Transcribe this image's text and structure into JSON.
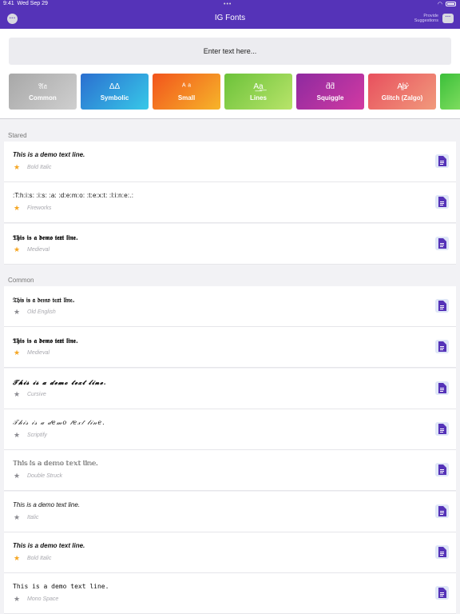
{
  "status": {
    "time": "9:41",
    "date": "Wed Sep 29",
    "dots": "•••",
    "wifi": "◠"
  },
  "header": {
    "title": "IG Fonts",
    "more_icon": "ellipsis-icon",
    "suggest_label_line1": "Provide",
    "suggest_label_line2": "Suggestions",
    "suggest_icon": "chat-bubble-icon"
  },
  "colors": {
    "accent": "#5533b8",
    "star_on": "#f5a623",
    "star_off": "#8a8a90"
  },
  "input": {
    "placeholder": "Enter text here...",
    "value": ""
  },
  "categories": [
    {
      "glyph": "𝔄𝔞",
      "label": "Common"
    },
    {
      "glyph": "ΔΔ",
      "label": "Symbolic"
    },
    {
      "glyph": "ᴬ ᵃ",
      "label": "Small"
    },
    {
      "glyph": "A͟a͟",
      "label": "Lines"
    },
    {
      "glyph": "ƌƌ",
      "label": "Squiggle"
    },
    {
      "glyph": "A̸͚a̷͛",
      "label": "Glitch (Zalgo)"
    },
    {
      "glyph": "",
      "label": ""
    }
  ],
  "stared": {
    "title": "Stared",
    "items": [
      {
        "text": "This is a demo text line.",
        "style": "Bold Italic",
        "starred": true
      },
      {
        "text": ":T:h:i:s: :i:s: :a: :d:e:m:o: :t:e:x:t: :l:i:n:e:.:",
        "style": "Fireworks",
        "starred": true
      },
      {
        "text": "𝕿𝖍𝖎𝖘 𝖎𝖘 𝖆 𝖉𝖊𝖒𝖔 𝖙𝖊𝖝𝖙 𝖑𝖎𝖓𝖊.",
        "style": "Medieval",
        "starred": true
      }
    ]
  },
  "common": {
    "title": "Common",
    "items": [
      {
        "text": "𝔗𝔥𝔦𝔰 𝔦𝔰 𝔞 𝔡𝔢𝔪𝔬 𝔱𝔢𝔵𝔱 𝔩𝔦𝔫𝔢.",
        "style": "Old English",
        "starred": false
      },
      {
        "text": "𝕿𝖍𝖎𝖘 𝖎𝖘 𝖆 𝖉𝖊𝖒𝖔 𝖙𝖊𝖝𝖙 𝖑𝖎𝖓𝖊.",
        "style": "Medieval",
        "starred": true
      },
      {
        "text": "𝓣𝓱𝓲𝓼 𝓲𝓼 𝓪 𝓭𝓮𝓶𝓸 𝓽𝓮𝔁𝓽 𝓵𝓲𝓷𝓮.",
        "style": "Cursive",
        "starred": false
      },
      {
        "text": "𝒯𝒽𝒾𝓈 𝒾𝓈 𝒶 𝒹𝑒𝓂𝑜 𝓉𝑒𝓍𝓉 𝓁𝒾𝓃𝑒.",
        "style": "Scriptify",
        "starred": false
      },
      {
        "text": "𝕋𝕙𝕚𝕤 𝕚𝕤 𝕒 𝕕𝕖𝕞𝕠 𝕥𝕖𝕩𝕥 𝕝𝕚𝕟𝕖.",
        "style": "Double Struck",
        "starred": false
      },
      {
        "text": "This is a demo text line.",
        "style": "Italic",
        "starred": false
      },
      {
        "text": "This is a demo text line.",
        "style": "Bold Italic",
        "starred": true
      },
      {
        "text": "𝚃𝚑𝚒𝚜 𝚒𝚜 𝚊 𝚍𝚎𝚖𝚘 𝚝𝚎𝚡𝚝 𝚕𝚒𝚗𝚎.",
        "style": "Mono Space",
        "starred": false
      }
    ]
  }
}
